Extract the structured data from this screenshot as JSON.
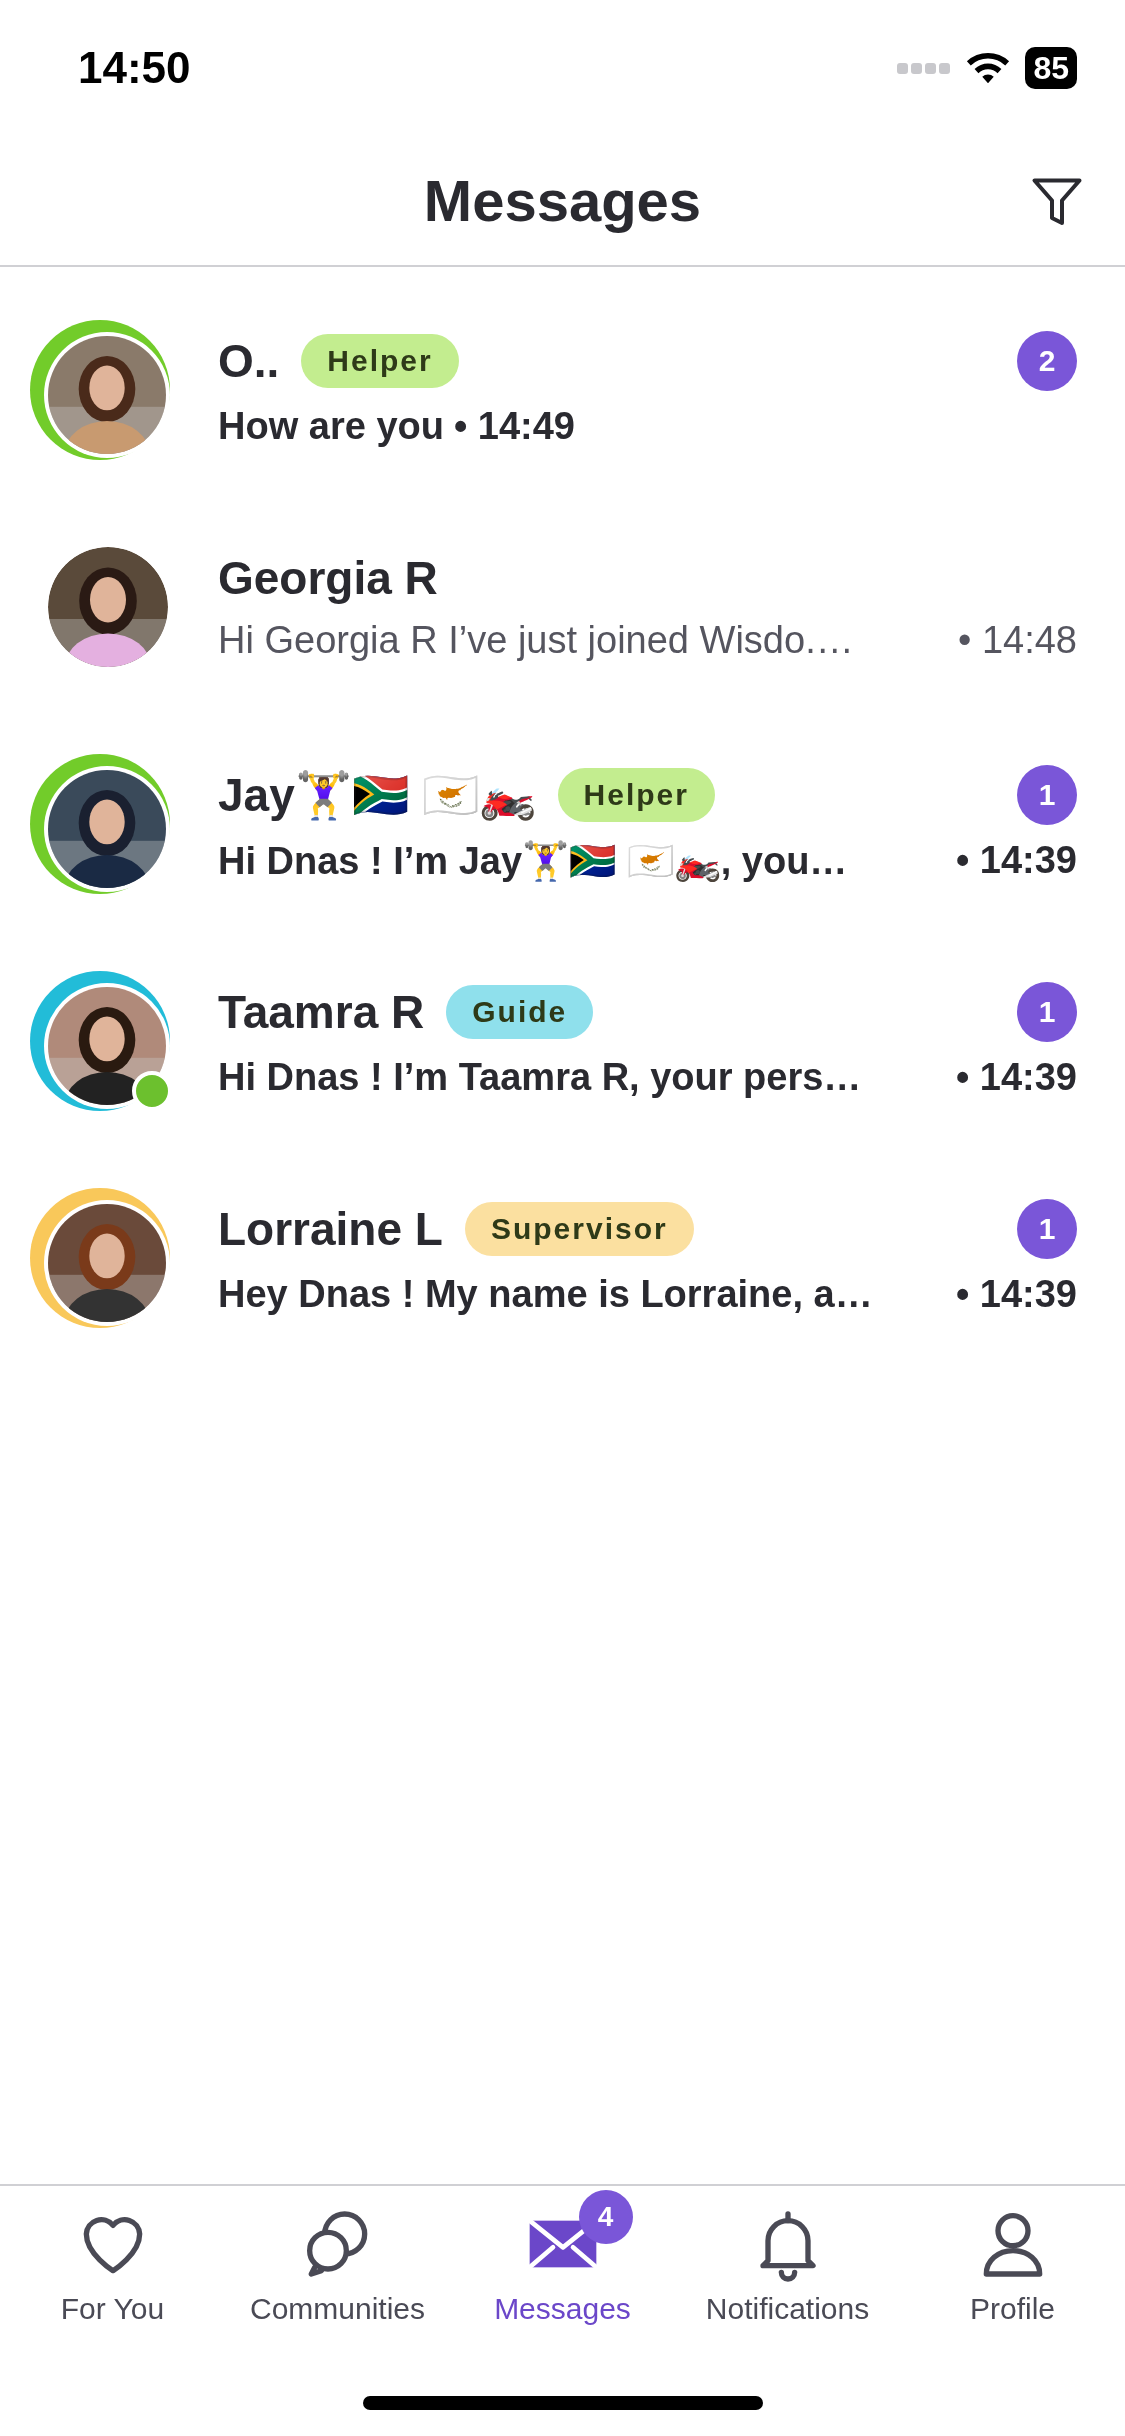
{
  "status_bar": {
    "time": "14:50",
    "battery": "85"
  },
  "header": {
    "title": "Messages"
  },
  "conversations": [
    {
      "name": "O..",
      "role": "Helper",
      "color": "#c3ed8f",
      "ring": {
        "color": "#72cc2a"
      },
      "online": false,
      "unread": true,
      "unread_count": "2",
      "preview": "How are you",
      "time": "• 14:49"
    },
    {
      "name": "Georgia R",
      "online": false,
      "unread": false,
      "preview": "Hi Georgia R I’ve just joined Wisdo.…",
      "time": "• 14:48"
    },
    {
      "name": "Jay🏋️‍♀️🇿🇦 🇨🇾🏍️",
      "role": "Helper",
      "color": "#c3ed8f",
      "ring": {
        "color": "#72cc2a"
      },
      "online": false,
      "unread": true,
      "unread_count": "1",
      "preview": "Hi Dnas ! I’m Jay🏋️‍♀️🇿🇦 🇨🇾🏍️, you…",
      "time": "• 14:39"
    },
    {
      "name": "Taamra R",
      "role": "Guide",
      "color": "#8fe0ec",
      "ring": {
        "color": "#22bcd8"
      },
      "online": true,
      "unread": true,
      "unread_count": "1",
      "preview": "Hi Dnas ! I’m Taamra R, your pers…",
      "time": "• 14:39"
    },
    {
      "name": "Lorraine L",
      "role": "Supervisor",
      "color": "#fbe0a0",
      "ring": {
        "color": "#f9c85a"
      },
      "online": false,
      "unread": true,
      "unread_count": "1",
      "preview": "Hey Dnas ! My name is Lorraine, a…",
      "time": "• 14:39"
    }
  ],
  "tab_bar": [
    {
      "kind": "heart",
      "label": "For You",
      "selected": false
    },
    {
      "kind": "chat",
      "label": "Communities",
      "selected": false
    },
    {
      "kind": "mail",
      "label": "Messages",
      "selected": true,
      "badge": "4"
    },
    {
      "kind": "bell",
      "label": "Notifications",
      "selected": false
    },
    {
      "kind": "person",
      "label": "Profile",
      "selected": false
    }
  ]
}
